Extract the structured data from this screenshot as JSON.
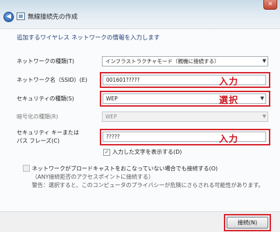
{
  "window": {
    "title": "無線接続先の作成",
    "close_label": "×",
    "back_label": "◀"
  },
  "instruction": "追加するワイヤレス ネットワークの情報を入力します",
  "fields": {
    "network_type": {
      "label": "ネットワークの種類(T)",
      "value": "インフラストラクチャモード（親機に接続する）"
    },
    "ssid": {
      "label": "ネットワーク名（SSID）(E)",
      "value": "001601?????"
    },
    "security_type": {
      "label": "セキュリティの種類(S)",
      "value": "WEP"
    },
    "encryption_type": {
      "label": "暗号化の種類(R)",
      "value": "WEP"
    },
    "security_key": {
      "label_line1": "セキュリティ キーまたは",
      "label_line2": "パス フレーズ(C)",
      "value": "?????"
    }
  },
  "show_chars": {
    "label": "入力した文字を表示する(D)",
    "checked": true
  },
  "connect_nonbroadcast": {
    "line1": "ネットワークがブロードキャストをおこなっていない場合でも接続する(O)",
    "line2": "（ANY接続拒否のアクセスポイントに接続する）",
    "line3": "警告：選択すると、このコンピュータのプライバシーが危険にさらされる可能性があります。",
    "checked": false
  },
  "annotations": {
    "ssid": "入力",
    "security": "選択",
    "key": "入力"
  },
  "buttons": {
    "next": "接続(N)"
  },
  "colors": {
    "annotation": "#d9232d",
    "instruction": "#1f3f7a"
  }
}
